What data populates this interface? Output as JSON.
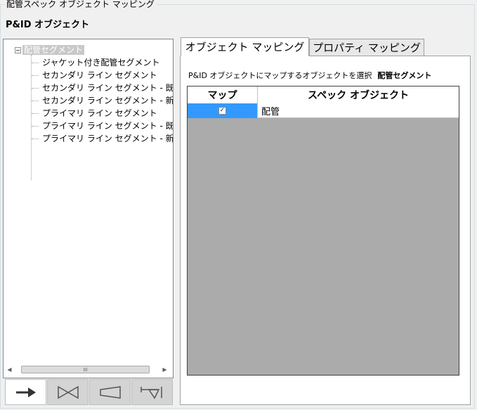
{
  "group": {
    "title": "配管スペック オブジェクト マッピング"
  },
  "section": {
    "title": "P&ID オブジェクト"
  },
  "tree": {
    "root_label": "配管セグメント",
    "items": [
      "ジャケット付き配管セグメント",
      "セカンダリ ライン セグメント",
      "セカンダリ ライン セグメント - 既",
      "セカンダリ ライン セグメント - 新",
      "プライマリ ライン セグメント",
      "プライマリ ライン セグメント - 既",
      "プライマリ ライン セグメント - 新"
    ]
  },
  "scrollbar": {
    "thumb_grip": "III"
  },
  "toolbar": {
    "buttons": [
      "arrow-right-icon",
      "valve-icon",
      "reducer-icon",
      "pipe-connector-icon"
    ]
  },
  "tabs": [
    {
      "label": "オブジェクト マッピング",
      "active": true
    },
    {
      "label": "プロパティ マッピング",
      "active": false
    }
  ],
  "mapping": {
    "select_prompt": "P&ID オブジェクトにマップするオブジェクトを選択",
    "selected_object": "配管セグメント",
    "columns": [
      "マップ",
      "スペック オブジェクト"
    ],
    "rows": [
      {
        "checked": true,
        "check_glyph": "✓",
        "spec_object": "配管"
      }
    ]
  },
  "colors": {
    "selection": "#3399ff",
    "grid_empty": "#ababab",
    "window_bg": "#f0f0f0"
  }
}
